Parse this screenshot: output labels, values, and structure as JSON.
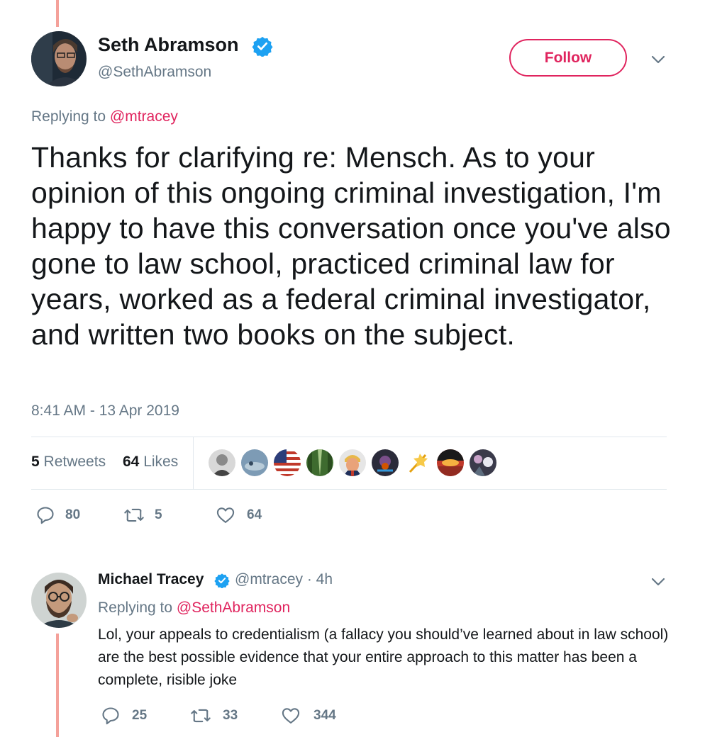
{
  "main_tweet": {
    "author_name": "Seth Abramson",
    "author_handle": "@SethAbramson",
    "follow_label": "Follow",
    "replying_prefix": "Replying to",
    "replying_handle": "@mtracey",
    "text": "Thanks for clarifying re: Mensch. As to your opinion of this ongoing criminal investigation, I'm happy to have this conversation once you've also gone to law school, practiced criminal law for years, worked as a federal criminal investigator, and written two books on the subject.",
    "timestamp": "8:41 AM - 13 Apr 2019",
    "retweets_count": "5",
    "retweets_label": "Retweets",
    "likes_count": "64",
    "likes_label": "Likes",
    "actions": {
      "replies": "80",
      "retweets": "5",
      "likes": "64"
    },
    "likers": [
      "liker-avatar-1",
      "liker-avatar-2",
      "liker-avatar-3",
      "liker-avatar-4",
      "liker-avatar-5",
      "liker-avatar-6",
      "liker-avatar-7",
      "liker-avatar-8",
      "liker-avatar-9"
    ]
  },
  "reply_tweet": {
    "author_name": "Michael Tracey",
    "author_handle_time": "@mtracey · 4h",
    "replying_prefix": "Replying to",
    "replying_handle": "@SethAbramson",
    "text": "Lol, your appeals to credentialism (a fallacy you should’ve learned about in law school) are the best possible evidence that your entire approach to this matter has been a complete, risible joke",
    "actions": {
      "replies": "25",
      "retweets": "33",
      "likes": "344"
    }
  },
  "top_cutoff_counts": [
    "9",
    "14",
    "142"
  ],
  "colors": {
    "accent": "#e0245e",
    "verified": "#1da1f2",
    "thread_line": "#f4a19a",
    "muted": "#657786"
  }
}
